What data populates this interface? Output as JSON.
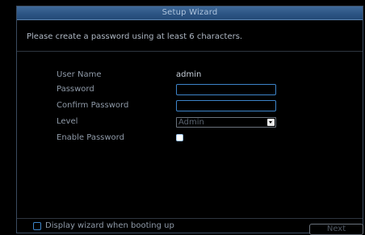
{
  "window": {
    "title": "Setup Wizard"
  },
  "instruction": "Please create a password using at least 6 characters.",
  "form": {
    "user_name_label": "User Name",
    "user_name_value": "admin",
    "password_label": "Password",
    "password_value": "",
    "confirm_password_label": "Confirm Password",
    "confirm_password_value": "",
    "level_label": "Level",
    "level_value": "Admin",
    "enable_password_label": "Enable Password",
    "enable_password_checked": false
  },
  "footer": {
    "display_wizard_label": "Display wizard when booting up",
    "display_wizard_checked": false,
    "next_label": "Next"
  },
  "colors": {
    "title_bar": "#2d5584",
    "input_border": "#3d84c9",
    "label_text": "#8f9aa8",
    "value_text": "#c8d0da",
    "disabled_text": "#5b6470"
  },
  "icons": {
    "select_arrow": "chevron-down-icon",
    "checkbox": "checkbox-icon"
  }
}
